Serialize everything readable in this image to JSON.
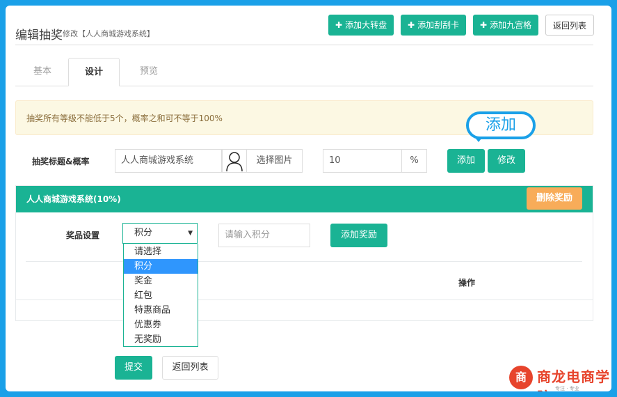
{
  "header": {
    "title": "编辑抽奖",
    "subtitle": "修改【人人商城游戏系统】",
    "buttons": {
      "add_wheel": "添加大转盘",
      "add_scratch": "添加刮刮卡",
      "add_nine": "添加九宫格",
      "back": "返回列表"
    }
  },
  "tabs": [
    "基本",
    "设计",
    "预览"
  ],
  "active_tab": "设计",
  "alert": "抽奖所有等级不能低于5个，概率之和可不等于100%",
  "callout": "添加",
  "form": {
    "title_label": "抽奖标题&概率",
    "title_value": "人人商城游戏系统",
    "choose_image": "选择图片",
    "rate_value": "10",
    "rate_unit": "%",
    "add_btn": "添加",
    "edit_btn": "修改"
  },
  "panel": {
    "heading": "人人商城游戏系统(10%)",
    "delete_btn": "删除奖励",
    "prize_label": "奖品设置",
    "select_value": "积分",
    "points_placeholder": "请输入积分",
    "add_reward_btn": "添加奖励",
    "column_action": "操作"
  },
  "dropdown_options": [
    "请选择",
    "积分",
    "奖金",
    "红包",
    "特惠商品",
    "优惠券",
    "无奖励"
  ],
  "dropdown_selected_index": 1,
  "footer": {
    "submit": "提交",
    "back": "返回列表"
  },
  "logo": {
    "mark": "商",
    "name": "商龙电商学院",
    "tagline": "专注 · 专业"
  },
  "colors": {
    "primary": "#1ab394",
    "warning": "#f8ac59",
    "frame": "#1aa0e8",
    "selected": "#2f96fd"
  }
}
